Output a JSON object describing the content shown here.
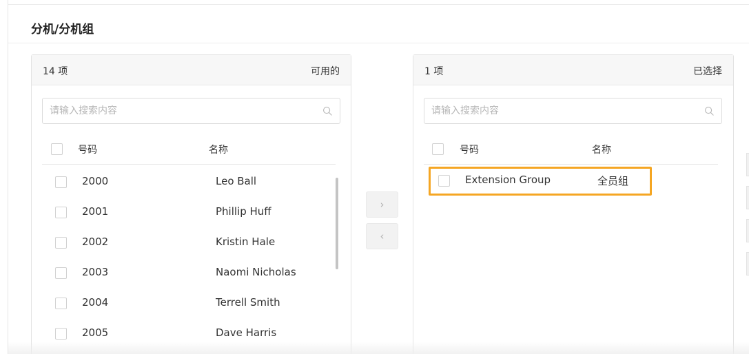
{
  "section": {
    "title": "分机/分机组"
  },
  "available": {
    "count": "14 项",
    "kind": "可用的",
    "search_placeholder": "请输入搜索内容",
    "columns": {
      "number": "号码",
      "name": "名称"
    },
    "rows": [
      {
        "number": "2000",
        "name": "Leo Ball"
      },
      {
        "number": "2001",
        "name": "Phillip Huff"
      },
      {
        "number": "2002",
        "name": "Kristin Hale"
      },
      {
        "number": "2003",
        "name": "Naomi Nicholas"
      },
      {
        "number": "2004",
        "name": "Terrell Smith"
      },
      {
        "number": "2005",
        "name": "Dave Harris"
      }
    ]
  },
  "selected": {
    "count": "1 项",
    "kind": "已选择",
    "search_placeholder": "请输入搜索内容",
    "columns": {
      "number": "号码",
      "name": "名称"
    },
    "rows": [
      {
        "number": "Extension Group",
        "name": "全员组"
      }
    ]
  },
  "controls": {
    "move_right": "›",
    "move_left": "‹"
  },
  "colors": {
    "highlight": "#f5a623",
    "border": "#e3e3e3",
    "header_bg": "#f7f7f7"
  }
}
